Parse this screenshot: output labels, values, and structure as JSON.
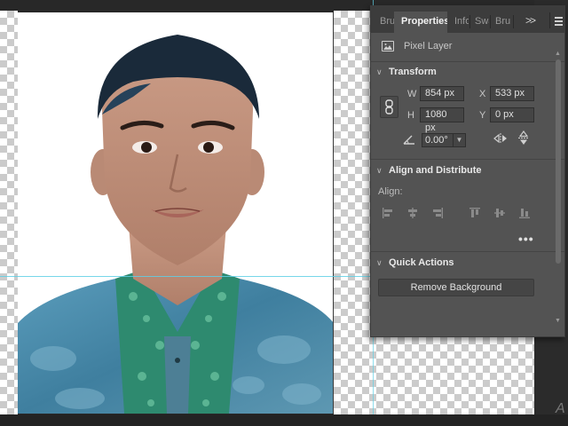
{
  "tabs": [
    {
      "label": "Bru",
      "active": false
    },
    {
      "label": "Properties",
      "active": true
    },
    {
      "label": "Info",
      "active": false
    },
    {
      "label": "Swa",
      "active": false
    },
    {
      "label": "Bru",
      "active": false
    }
  ],
  "tab_overflow": ">>",
  "layer_kind": "Pixel Layer",
  "transform": {
    "title": "Transform",
    "w_label": "W",
    "w_value": "854 px",
    "h_label": "H",
    "h_value": "1080 px",
    "x_label": "X",
    "x_value": "533 px",
    "y_label": "Y",
    "y_value": "0 px",
    "angle_value": "0.00°"
  },
  "align": {
    "title": "Align and Distribute",
    "align_label": "Align:",
    "more": "•••"
  },
  "quick_actions": {
    "title": "Quick Actions",
    "remove_background_label": "Remove Background"
  },
  "colors": {
    "panel_bg": "#535353",
    "tab_bar": "#3c3c3c",
    "guide": "#5fd0e6",
    "shirt": "#4a8fb0"
  }
}
